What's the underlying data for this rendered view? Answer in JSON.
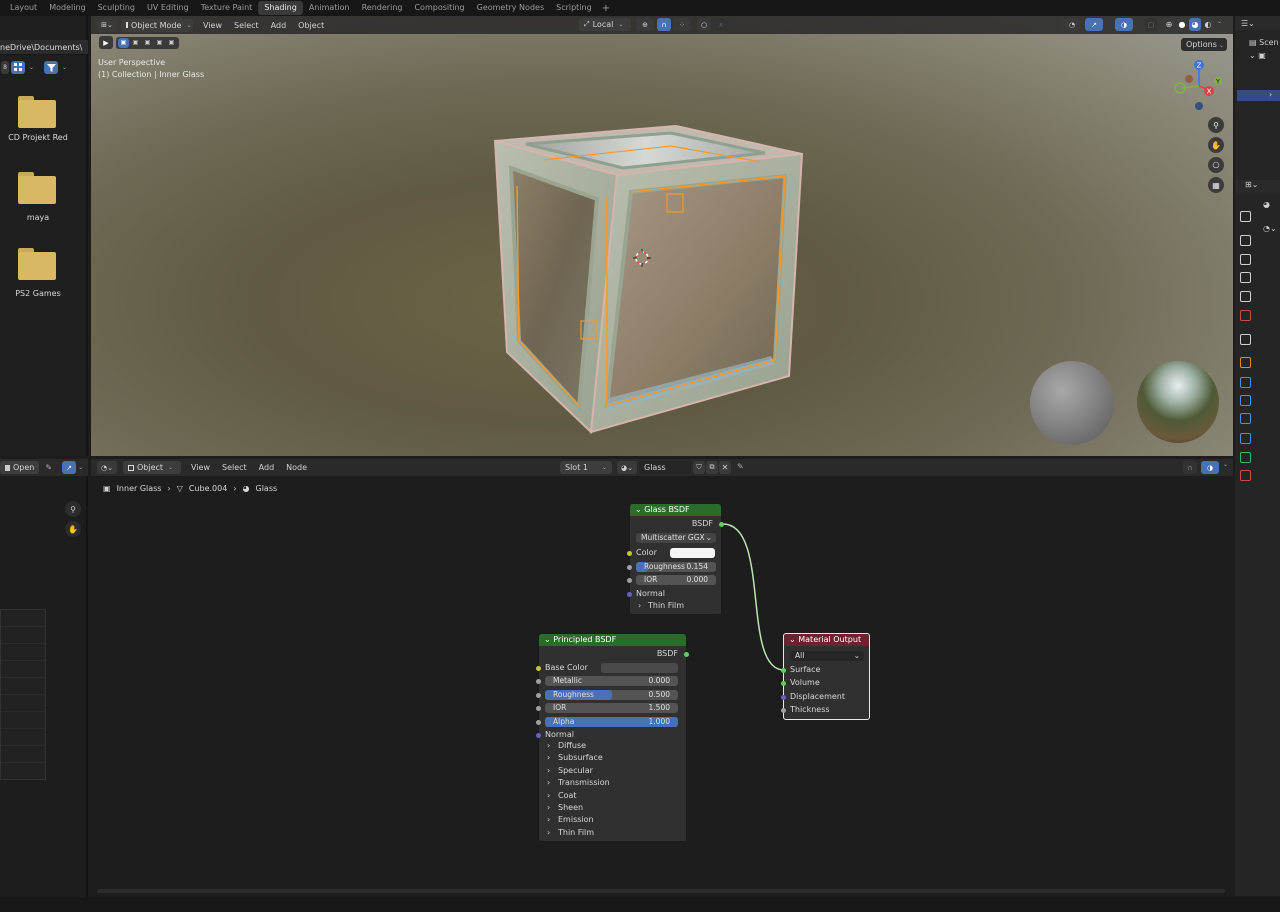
{
  "top_tabs": [
    "Layout",
    "Modeling",
    "Sculpting",
    "UV Editing",
    "Texture Paint",
    "Shading",
    "Animation",
    "Rendering",
    "Compositing",
    "Geometry Nodes",
    "Scripting"
  ],
  "active_tab": "Shading",
  "file_browser": {
    "path": "neDrive\\Documents\\",
    "folders": [
      "CD Projekt Red",
      "maya",
      "PS2 Games"
    ]
  },
  "viewport": {
    "mode": "Object Mode",
    "menus": [
      "View",
      "Select",
      "Add",
      "Object"
    ],
    "orientation": "Local",
    "options_label": "Options",
    "overlay_line1": "User Perspective",
    "overlay_line2": "(1) Collection | Inner Glass",
    "gizmo_axes": {
      "z": "Z",
      "y": "Y",
      "x": "X"
    }
  },
  "node_editor": {
    "type": "Object",
    "menus": [
      "View",
      "Select",
      "Add",
      "Node"
    ],
    "slot": "Slot 1",
    "material": "Glass",
    "open_label": "Open",
    "breadcrumb": {
      "object": "Inner Glass",
      "mesh": "Cube.004",
      "material": "Glass"
    },
    "glass_node": {
      "title": "Glass BSDF",
      "output": "BSDF",
      "distribution": "Multiscatter GGX",
      "color_label": "Color",
      "roughness_label": "Roughness",
      "roughness_value": "0.154",
      "roughness_fraction": 0.154,
      "ior_label": "IOR",
      "ior_value": "0.000",
      "normal_label": "Normal",
      "thin_film_label": "Thin Film"
    },
    "principled_node": {
      "title": "Principled BSDF",
      "output": "BSDF",
      "base_color_label": "Base Color",
      "metallic_label": "Metallic",
      "metallic_value": "0.000",
      "roughness_label": "Roughness",
      "roughness_value": "0.500",
      "roughness_fraction": 0.5,
      "ior_label": "IOR",
      "ior_value": "1.500",
      "alpha_label": "Alpha",
      "alpha_value": "1.000",
      "alpha_fraction": 1.0,
      "normal_label": "Normal",
      "panels": [
        "Diffuse",
        "Subsurface",
        "Specular",
        "Transmission",
        "Coat",
        "Sheen",
        "Emission",
        "Thin Film"
      ]
    },
    "output_node": {
      "title": "Material Output",
      "target": "All",
      "inputs": [
        "Surface",
        "Volume",
        "Displacement",
        "Thickness"
      ]
    }
  },
  "outliner": {
    "scene_label": "Scen"
  },
  "colors": {
    "accent": "#4772b3",
    "shader_header": "#2b6b2b",
    "output_header": "#6b2330",
    "shader_socket": "#5fd15f",
    "vector_socket": "#6363c7",
    "float_socket": "#a1a1a1",
    "color_socket": "#c7c729"
  }
}
